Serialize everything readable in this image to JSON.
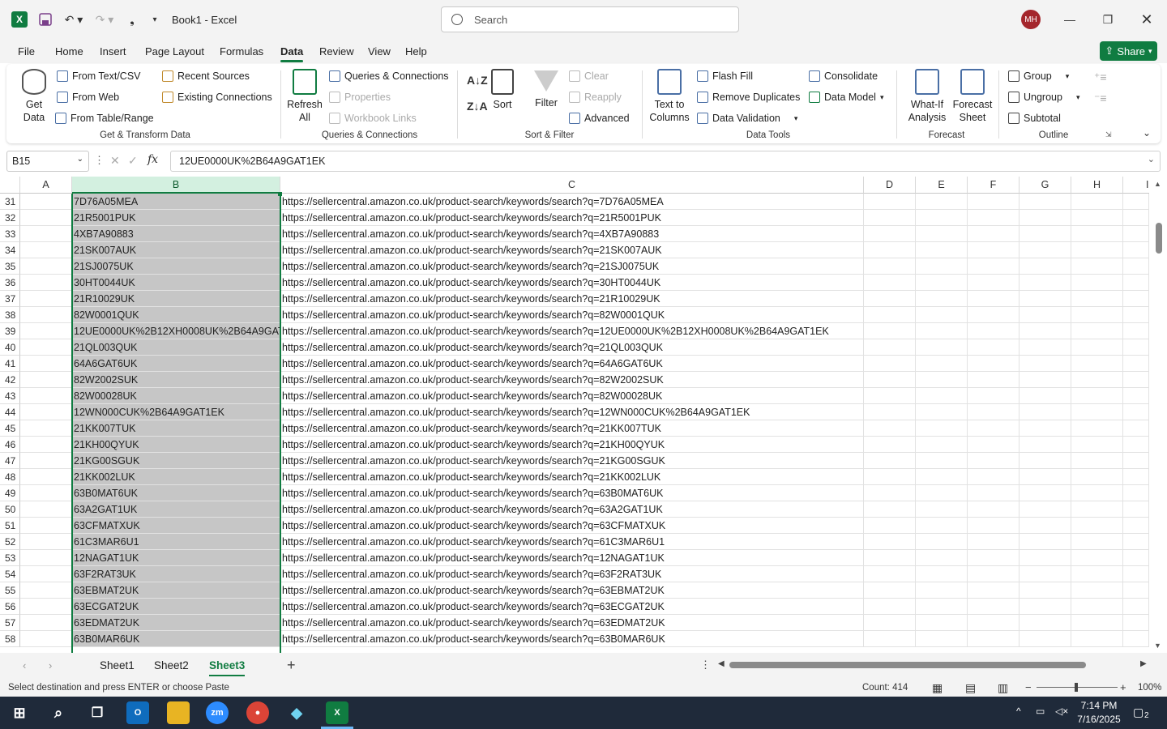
{
  "window": {
    "title": "Book1  -  Excel",
    "search_placeholder": "Search",
    "avatar_initials": "MH"
  },
  "menu": [
    "File",
    "Home",
    "Insert",
    "Page Layout",
    "Formulas",
    "Data",
    "Review",
    "View",
    "Help"
  ],
  "menu_active": "Data",
  "share_label": "Share",
  "ribbon": {
    "get_data": "Get\nData",
    "from_text_csv": "From Text/CSV",
    "from_web": "From Web",
    "from_table_range": "From Table/Range",
    "recent_sources": "Recent Sources",
    "existing_connections": "Existing Connections",
    "group_get_transform": "Get & Transform Data",
    "refresh_all": "Refresh\nAll",
    "queries_connections": "Queries & Connections",
    "properties": "Properties",
    "workbook_links": "Workbook Links",
    "group_queries": "Queries & Connections",
    "sort": "Sort",
    "filter": "Filter",
    "clear": "Clear",
    "reapply": "Reapply",
    "advanced": "Advanced",
    "group_sort_filter": "Sort & Filter",
    "text_to_columns": "Text to\nColumns",
    "flash_fill": "Flash Fill",
    "remove_duplicates": "Remove Duplicates",
    "data_validation": "Data Validation",
    "consolidate": "Consolidate",
    "data_model": "Data Model",
    "group_data_tools": "Data Tools",
    "what_if": "What-If\nAnalysis",
    "forecast_sheet": "Forecast\nSheet",
    "group_forecast": "Forecast",
    "group_btn": "Group",
    "ungroup_btn": "Ungroup",
    "subtotal_btn": "Subtotal",
    "group_outline": "Outline"
  },
  "namebox": "B15",
  "formula": "12UE0000UK%2B64A9GAT1EK",
  "columns": [
    "A",
    "B",
    "C",
    "D",
    "E",
    "F",
    "G",
    "H",
    "I"
  ],
  "rows": [
    {
      "n": "31",
      "b": "7D76A05MEA",
      "c": "https://sellercentral.amazon.co.uk/product-search/keywords/search?q=7D76A05MEA"
    },
    {
      "n": "32",
      "b": "21R5001PUK",
      "c": "https://sellercentral.amazon.co.uk/product-search/keywords/search?q=21R5001PUK"
    },
    {
      "n": "33",
      "b": "4XB7A90883",
      "c": "https://sellercentral.amazon.co.uk/product-search/keywords/search?q=4XB7A90883"
    },
    {
      "n": "34",
      "b": "21SK007AUK",
      "c": "https://sellercentral.amazon.co.uk/product-search/keywords/search?q=21SK007AUK"
    },
    {
      "n": "35",
      "b": "21SJ0075UK",
      "c": "https://sellercentral.amazon.co.uk/product-search/keywords/search?q=21SJ0075UK"
    },
    {
      "n": "36",
      "b": "30HT0044UK",
      "c": "https://sellercentral.amazon.co.uk/product-search/keywords/search?q=30HT0044UK"
    },
    {
      "n": "37",
      "b": "21R10029UK",
      "c": "https://sellercentral.amazon.co.uk/product-search/keywords/search?q=21R10029UK"
    },
    {
      "n": "38",
      "b": "82W0001QUK",
      "c": "https://sellercentral.amazon.co.uk/product-search/keywords/search?q=82W0001QUK"
    },
    {
      "n": "39",
      "b": "12UE0000UK%2B12XH0008UK%2B64A9GAT",
      "c": "https://sellercentral.amazon.co.uk/product-search/keywords/search?q=12UE0000UK%2B12XH0008UK%2B64A9GAT1EK"
    },
    {
      "n": "40",
      "b": "21QL003QUK",
      "c": "https://sellercentral.amazon.co.uk/product-search/keywords/search?q=21QL003QUK"
    },
    {
      "n": "41",
      "b": "64A6GAT6UK",
      "c": "https://sellercentral.amazon.co.uk/product-search/keywords/search?q=64A6GAT6UK"
    },
    {
      "n": "42",
      "b": "82W2002SUK",
      "c": "https://sellercentral.amazon.co.uk/product-search/keywords/search?q=82W2002SUK"
    },
    {
      "n": "43",
      "b": "82W00028UK",
      "c": "https://sellercentral.amazon.co.uk/product-search/keywords/search?q=82W00028UK"
    },
    {
      "n": "44",
      "b": "12WN000CUK%2B64A9GAT1EK",
      "c": "https://sellercentral.amazon.co.uk/product-search/keywords/search?q=12WN000CUK%2B64A9GAT1EK"
    },
    {
      "n": "45",
      "b": "21KK007TUK",
      "c": "https://sellercentral.amazon.co.uk/product-search/keywords/search?q=21KK007TUK"
    },
    {
      "n": "46",
      "b": "21KH00QYUK",
      "c": "https://sellercentral.amazon.co.uk/product-search/keywords/search?q=21KH00QYUK"
    },
    {
      "n": "47",
      "b": "21KG00SGUK",
      "c": "https://sellercentral.amazon.co.uk/product-search/keywords/search?q=21KG00SGUK"
    },
    {
      "n": "48",
      "b": "21KK002LUK",
      "c": "https://sellercentral.amazon.co.uk/product-search/keywords/search?q=21KK002LUK"
    },
    {
      "n": "49",
      "b": "63B0MAT6UK",
      "c": "https://sellercentral.amazon.co.uk/product-search/keywords/search?q=63B0MAT6UK"
    },
    {
      "n": "50",
      "b": "63A2GAT1UK",
      "c": "https://sellercentral.amazon.co.uk/product-search/keywords/search?q=63A2GAT1UK"
    },
    {
      "n": "51",
      "b": "63CFMATXUK",
      "c": "https://sellercentral.amazon.co.uk/product-search/keywords/search?q=63CFMATXUK"
    },
    {
      "n": "52",
      "b": "61C3MAR6U1",
      "c": "https://sellercentral.amazon.co.uk/product-search/keywords/search?q=61C3MAR6U1"
    },
    {
      "n": "53",
      "b": "12NAGAT1UK",
      "c": "https://sellercentral.amazon.co.uk/product-search/keywords/search?q=12NAGAT1UK"
    },
    {
      "n": "54",
      "b": "63F2RAT3UK",
      "c": "https://sellercentral.amazon.co.uk/product-search/keywords/search?q=63F2RAT3UK"
    },
    {
      "n": "55",
      "b": "63EBMAT2UK",
      "c": "https://sellercentral.amazon.co.uk/product-search/keywords/search?q=63EBMAT2UK"
    },
    {
      "n": "56",
      "b": "63ECGAT2UK",
      "c": "https://sellercentral.amazon.co.uk/product-search/keywords/search?q=63ECGAT2UK"
    },
    {
      "n": "57",
      "b": "63EDMAT2UK",
      "c": "https://sellercentral.amazon.co.uk/product-search/keywords/search?q=63EDMAT2UK"
    },
    {
      "n": "58",
      "b": "63B0MAR6UK",
      "c": "https://sellercentral.amazon.co.uk/product-search/keywords/search?q=63B0MAR6UK"
    }
  ],
  "sheets": [
    "Sheet1",
    "Sheet2",
    "Sheet3"
  ],
  "active_sheet": "Sheet3",
  "status": {
    "message": "Select destination and press ENTER or choose Paste",
    "count": "Count: 414",
    "zoom": "100%"
  },
  "taskbar": {
    "time": "7:14 PM",
    "date": "7/16/2025",
    "notifications": "2"
  },
  "colors": {
    "accent": "#107c41",
    "selection": "#c6c6c6",
    "avatar": "#a4262c"
  }
}
